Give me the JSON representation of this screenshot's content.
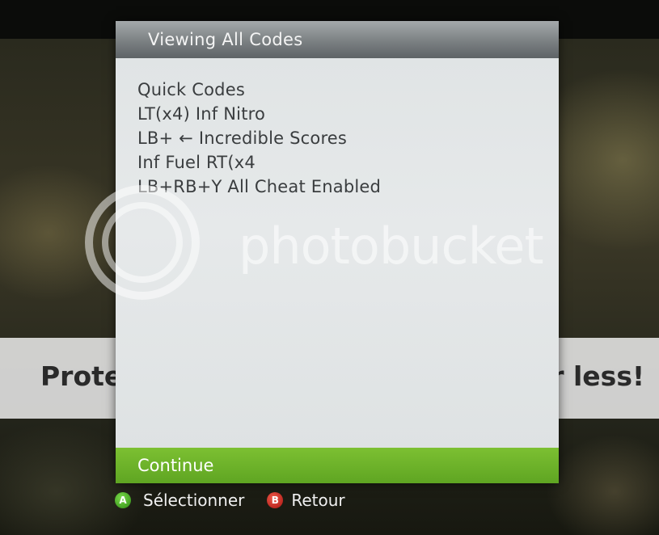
{
  "dialog": {
    "title": "Viewing All Codes",
    "codes": [
      "Quick Codes",
      "LT(x4) Inf Nitro",
      "LB+ ← Incredible Scores",
      "Inf Fuel RT(x4",
      "LB+RB+Y All Cheat Enabled"
    ],
    "continue_label": "Continue"
  },
  "banner": {
    "text": "Protect more of your memories for less!"
  },
  "watermark": {
    "text": "photobucket"
  },
  "hints": {
    "a_glyph": "A",
    "a_label": "Sélectionner",
    "b_glyph": "B",
    "b_label": "Retour"
  },
  "colors": {
    "accent_green": "#6cb12a",
    "button_a": "#3fa51c",
    "button_b": "#c8201a"
  }
}
